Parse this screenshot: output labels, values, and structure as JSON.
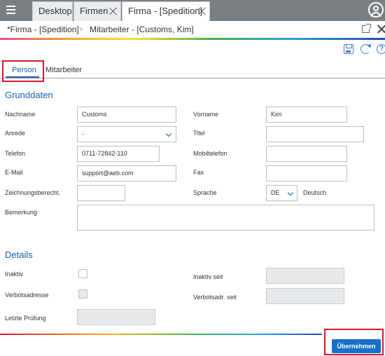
{
  "tabs": [
    {
      "label": "Desktop"
    },
    {
      "label": "Firmen"
    },
    {
      "label": "Firma - [Spedition]"
    }
  ],
  "breadcrumb": {
    "parent": "*Firma - [Spedition]",
    "current": "Mitarbeiter - [Customs, Kim]"
  },
  "inner_tabs": {
    "person": "Person",
    "mitarbeiter": "Mitarbeiter"
  },
  "grunddaten": {
    "title": "Grunddaten",
    "nachname_label": "Nachname",
    "nachname_value": "Customs",
    "vorname_label": "Vorname",
    "vorname_value": "Kim",
    "anrede_label": "Anrede",
    "anrede_value": "-",
    "titel_label": "Titel",
    "titel_value": "",
    "telefon_label": "Telefon",
    "telefon_value": "0711-72842-110",
    "mobil_label": "Mobiltelefon",
    "mobil_value": "",
    "email_label": "E-Mail",
    "email_value": "support@aeb.com",
    "fax_label": "Fax",
    "fax_value": "",
    "zeichnung_label": "Zeichnungsberecht.",
    "zeichnung_value": "",
    "sprache_label": "Sprache",
    "sprache_code": "DE",
    "sprache_name": "Deutsch",
    "bemerkung_label": "Bemerkung",
    "bemerkung_value": ""
  },
  "details": {
    "title": "Details",
    "inaktiv_label": "Inaktiv",
    "inaktiv_seit_label": "Inaktiv seit",
    "verbot_label": "Verbotsadresse",
    "verbot_seit_label": "Verbotsadr. seit",
    "pruefung_label": "Letzte Prüfung"
  },
  "footer": {
    "apply_label": "Übernehmen"
  },
  "colors": {
    "accent": "#1a5fb4",
    "highlight": "#d6172f",
    "button": "#1670cc"
  }
}
